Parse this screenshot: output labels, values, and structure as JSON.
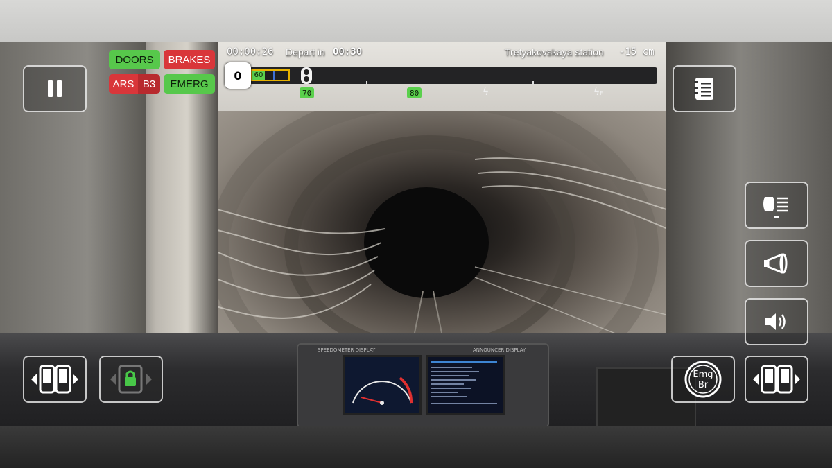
{
  "status_tags": {
    "doors": "DOORS",
    "brakes": "BRAKES",
    "ars": "ARS",
    "ars_mode": "B3",
    "emerg": "EMERG"
  },
  "trip": {
    "elapsed": "00:00:26",
    "depart_label": "Depart in",
    "depart_time": "00:30",
    "station": "Tretyakovskaya station",
    "distance": "-15 cm"
  },
  "speed": {
    "current": "0",
    "current_limit": "60",
    "limit_markers": [
      "70",
      "80"
    ]
  },
  "panels": {
    "speedometer_title": "SPEEDOMETER DISPLAY",
    "announcer_title": "ANNOUNCER DISPLAY"
  },
  "controls": {
    "emergency_brake": "Emg Br"
  },
  "icons": {
    "pause": "pause-icon",
    "timetable": "notebook-icon",
    "headlights": "headlight-icon",
    "horn": "horn-icon",
    "sound": "speaker-icon",
    "doors_left": "doors-left-icon",
    "lock": "lock-icon",
    "doors_right": "doors-right-icon"
  }
}
